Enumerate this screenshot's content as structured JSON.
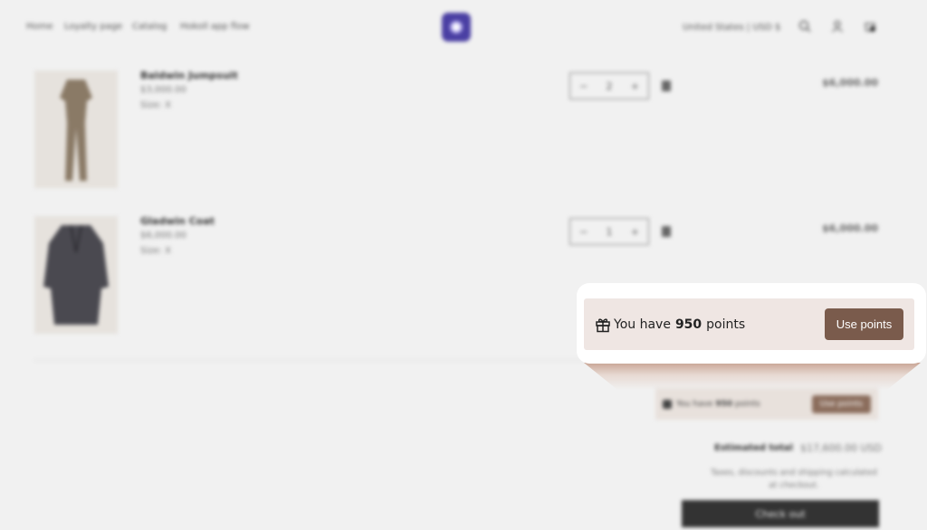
{
  "header": {
    "nav": [
      "Home",
      "Loyalty page",
      "Catalog",
      "Hokoll app flow"
    ],
    "currency": "United States | USD $"
  },
  "cart": {
    "items": [
      {
        "name": "Baldwin Jumpsuit",
        "price": "$3,000.00",
        "size": "Size: X",
        "qty": "2",
        "total": "$6,000.00"
      },
      {
        "name": "Gladwin Coat",
        "price": "$6,000.00",
        "size": "Size: X",
        "qty": "1",
        "total": "$6,000.00"
      }
    ],
    "qty_minus": "−",
    "qty_plus": "+"
  },
  "loyalty": {
    "prefix": "You have",
    "points": "950",
    "suffix": "points",
    "button": "Use points"
  },
  "summary": {
    "estimated_label": "Estimated total",
    "estimated_value": "$17,600.00 USD",
    "tax_note": "Taxes, discounts and shipping calculated at checkout.",
    "checkout_label": "Check out"
  },
  "colors": {
    "brand": "#4a3fa3",
    "loyalty_bg": "#efe6e3",
    "loyalty_button": "#7a5b4c"
  }
}
